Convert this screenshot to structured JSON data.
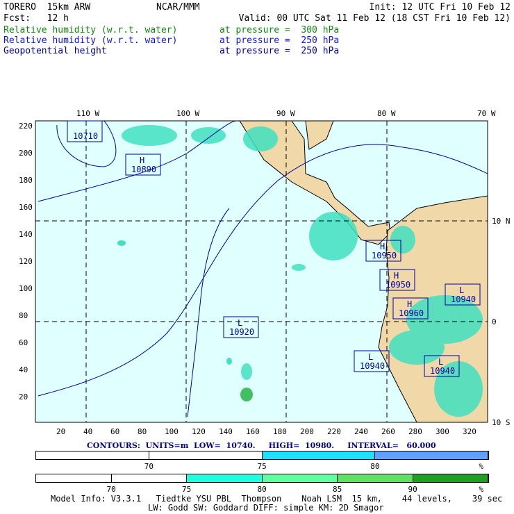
{
  "header": {
    "model": "TORERO  15km ARW",
    "org": "NCAR/MMM",
    "init": "Init: 12 UTC Fri 10 Feb 12",
    "fcst": "Fcst:   12 h",
    "valid": "Valid: 00 UTC Sat 11 Feb 12 (18 CST Fri 10 Feb 12)",
    "fields": [
      {
        "name": "Relative humidity (w.r.t. water)",
        "level": "at pressure =  300 hPa",
        "color": "#118811"
      },
      {
        "name": "Relative humidity (w.r.t. water)",
        "level": "at pressure =  250 hPa",
        "color": "#1010e0"
      },
      {
        "name": "Geopotential height",
        "level": "at pressure =  250 hPa",
        "color": "#1010e0"
      }
    ]
  },
  "map": {
    "lon_labels": [
      "110 W",
      "100 W",
      "90 W",
      "80 W",
      "70 W"
    ],
    "lat_labels": [
      "10 N",
      "0",
      "10 S"
    ],
    "y_ticks": [
      "220",
      "200",
      "180",
      "160",
      "140",
      "120",
      "100",
      "80",
      "60",
      "40",
      "20"
    ],
    "x_ticks": [
      "20",
      "40",
      "60",
      "80",
      "100",
      "120",
      "140",
      "160",
      "180",
      "200",
      "220",
      "240",
      "260",
      "280",
      "300",
      "320"
    ],
    "centers": [
      {
        "type": "",
        "value": "10710"
      },
      {
        "type": "H",
        "value": "10890"
      },
      {
        "type": "H",
        "value": "10950"
      },
      {
        "type": "H",
        "value": "10950"
      },
      {
        "type": "L",
        "value": "10940"
      },
      {
        "type": "H",
        "value": "10960"
      },
      {
        "type": "L",
        "value": "10920"
      },
      {
        "type": "L",
        "value": "10940"
      },
      {
        "type": "L",
        "value": "10940"
      }
    ]
  },
  "contours": "CONTOURS:  UNITS=m  LOW=  10740.     HIGH=  10980.     INTERVAL=   60.000",
  "bar1": {
    "labels": [
      "70",
      "75",
      "80",
      "%"
    ],
    "colors": [
      "#ffffff",
      "#ffffff",
      "#20e0ff",
      "#60a0ff"
    ]
  },
  "bar2": {
    "labels": [
      "70",
      "75",
      "80",
      "85",
      "90",
      "%"
    ],
    "colors": [
      "#ffffff",
      "#ffffff",
      "#20ffe0",
      "#60ffa0",
      "#60e060",
      "#20a020"
    ]
  },
  "footer": {
    "line1": "Model Info: V3.3.1   Tiedtke YSU PBL  Thompson    Noah LSM  15 km,    44 levels,    39 sec",
    "line2": "LW: Godd SW: Goddard DIFF: simple KM: 2D Smagor"
  }
}
